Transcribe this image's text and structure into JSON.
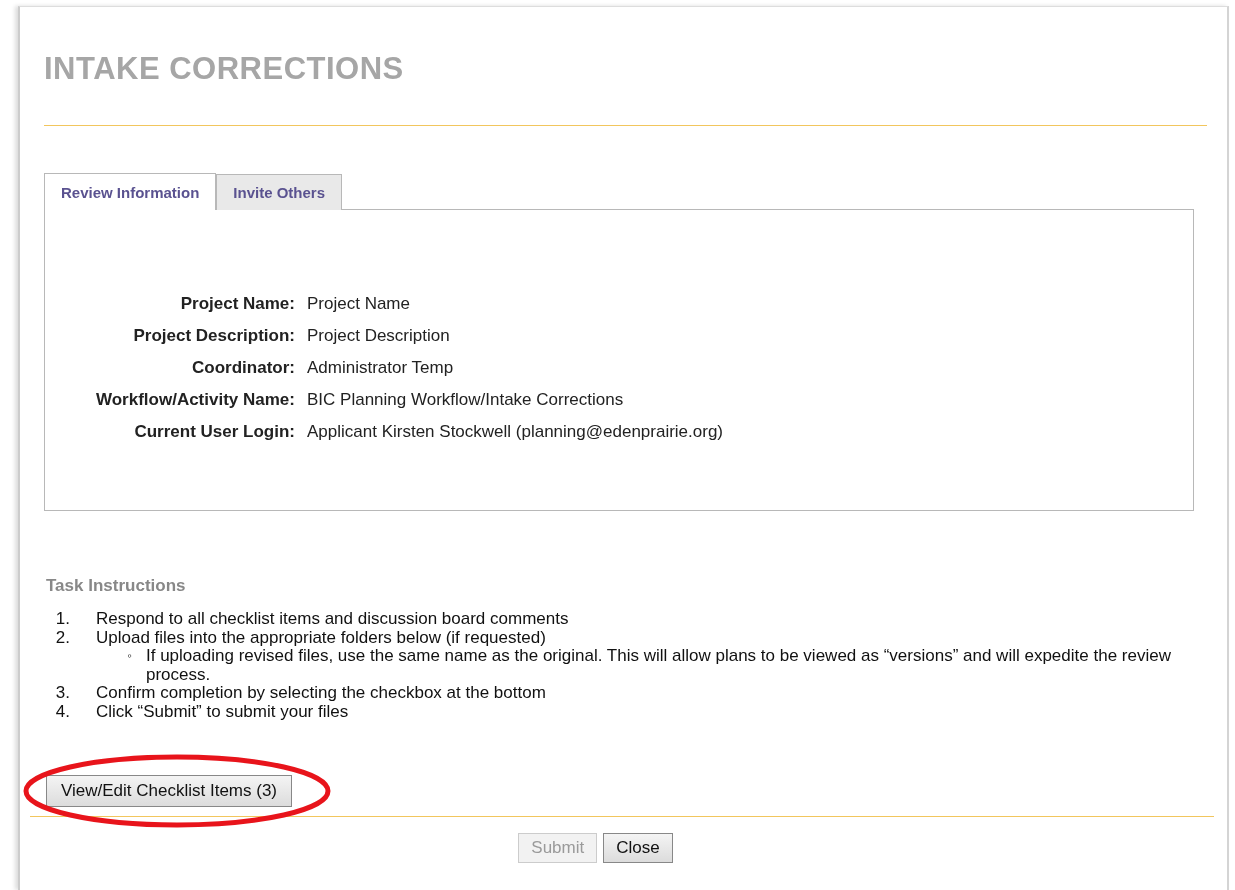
{
  "title": "INTAKE CORRECTIONS",
  "tabs": [
    {
      "label": "Review Information",
      "selected": true
    },
    {
      "label": "Invite Others",
      "selected": false
    }
  ],
  "fields": [
    {
      "label": "Project Name:",
      "value": "Project Name"
    },
    {
      "label": "Project Description:",
      "value": "Project Description"
    },
    {
      "label": "Coordinator:",
      "value": "Administrator Temp"
    },
    {
      "label": "Workflow/Activity Name:",
      "value": "BIC Planning Workflow/Intake Corrections"
    },
    {
      "label": "Current User Login:",
      "value": "Applicant Kirsten Stockwell (planning@edenprairie.org)"
    }
  ],
  "instructions": {
    "heading": "Task Instructions",
    "items": [
      {
        "marker": "1.",
        "text": "Respond to all checklist items and discussion board comments"
      },
      {
        "marker": "2.",
        "text": "Upload files into the appropriate folders below (if requested)",
        "children": [
          {
            "marker": "◦",
            "text": "If uploading revised files, use the same name as the original. This will allow plans to be viewed as “versions” and will expedite the review process."
          }
        ]
      },
      {
        "marker": "3.",
        "text": "Confirm completion by selecting the checkbox at the bottom"
      },
      {
        "marker": "4.",
        "text": "Click “Submit” to submit your files"
      }
    ]
  },
  "checklist_button": {
    "label": "View/Edit Checklist Items (3)",
    "highlighted": true
  },
  "buttons": [
    {
      "label": "Submit",
      "disabled": true
    },
    {
      "label": "Close",
      "disabled": false
    }
  ]
}
